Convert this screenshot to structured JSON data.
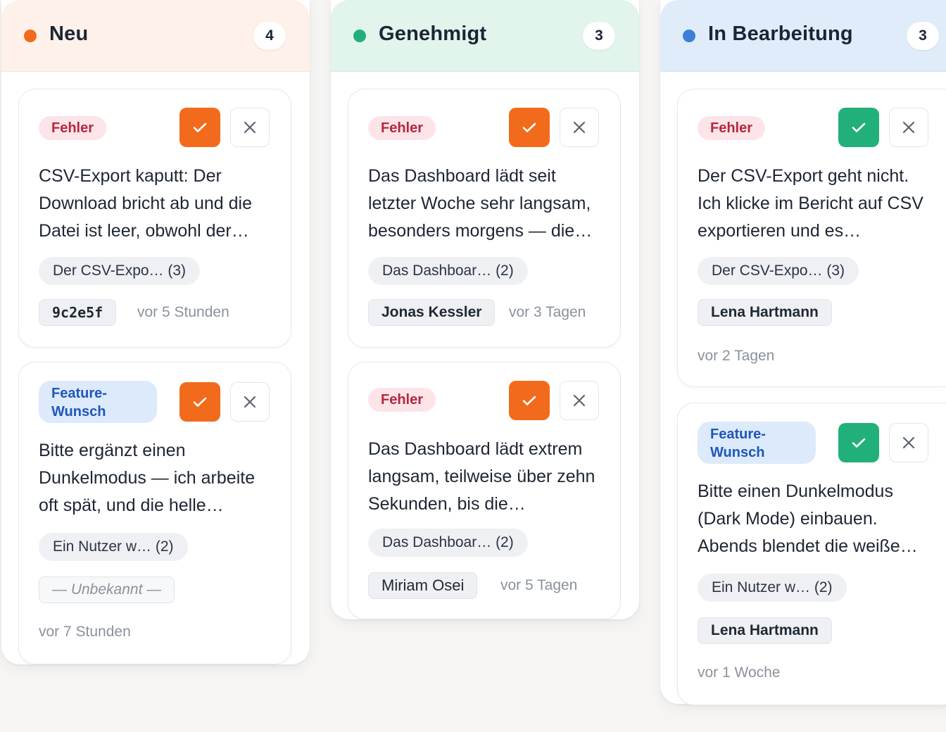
{
  "columns": [
    {
      "title": "Neu",
      "count": "4",
      "dot_color": "#f26b1d",
      "header_bg": "#fdf1e9",
      "cards": [
        {
          "tag": "Fehler",
          "text": "CSV-Export kaputt: Der Download bricht ab und die Datei ist leer, obwohl der…",
          "group": "Der CSV-Expo… (3)",
          "assignee": "9c2e5f",
          "time": "vor 5 Stunden"
        },
        {
          "tag": "Feature-Wunsch",
          "text": "Bitte ergänzt einen Dunkelmodus — ich arbeite oft spät, und die helle…",
          "group": "Ein Nutzer w… (2)",
          "assignee": "— Unbekannt —",
          "time": "vor 7 Stunden"
        }
      ]
    },
    {
      "title": "Genehmigt",
      "count": "3",
      "dot_color": "#22b07a",
      "header_bg": "#e1f5ec",
      "cards": [
        {
          "tag": "Fehler",
          "text": "Das Dashboard lädt seit letzter Woche sehr langsam, besonders morgens — die…",
          "group": "Das Dashboar… (2)",
          "assignee": "Jonas Kessler",
          "time": "vor 3 Tagen"
        },
        {
          "tag": "Fehler",
          "text": "Das Dashboard lädt extrem langsam, teilweise über zehn Sekunden, bis die…",
          "group": "Das Dashboar… (2)",
          "assignee": "Miriam Osei",
          "time": "vor 5 Tagen"
        }
      ]
    },
    {
      "title": "In Bearbeitung",
      "count": "3",
      "dot_color": "#3b7fd9",
      "header_bg": "#e0ecfa",
      "cards": [
        {
          "tag": "Fehler",
          "text": "Der CSV-Export geht nicht. Ich klicke im Bericht auf CSV exportieren und es…",
          "group": "Der CSV-Expo… (3)",
          "assignee": "Lena Hartmann",
          "time": "vor 2 Tagen"
        },
        {
          "tag": "Feature-Wunsch",
          "text": "Bitte einen Dunkelmodus (Dark Mode) einbauen. Abends blendet die weiße…",
          "group": "Ein Nutzer w… (2)",
          "assignee": "Lena Hartmann",
          "time": "vor 1 Woche"
        }
      ]
    }
  ]
}
